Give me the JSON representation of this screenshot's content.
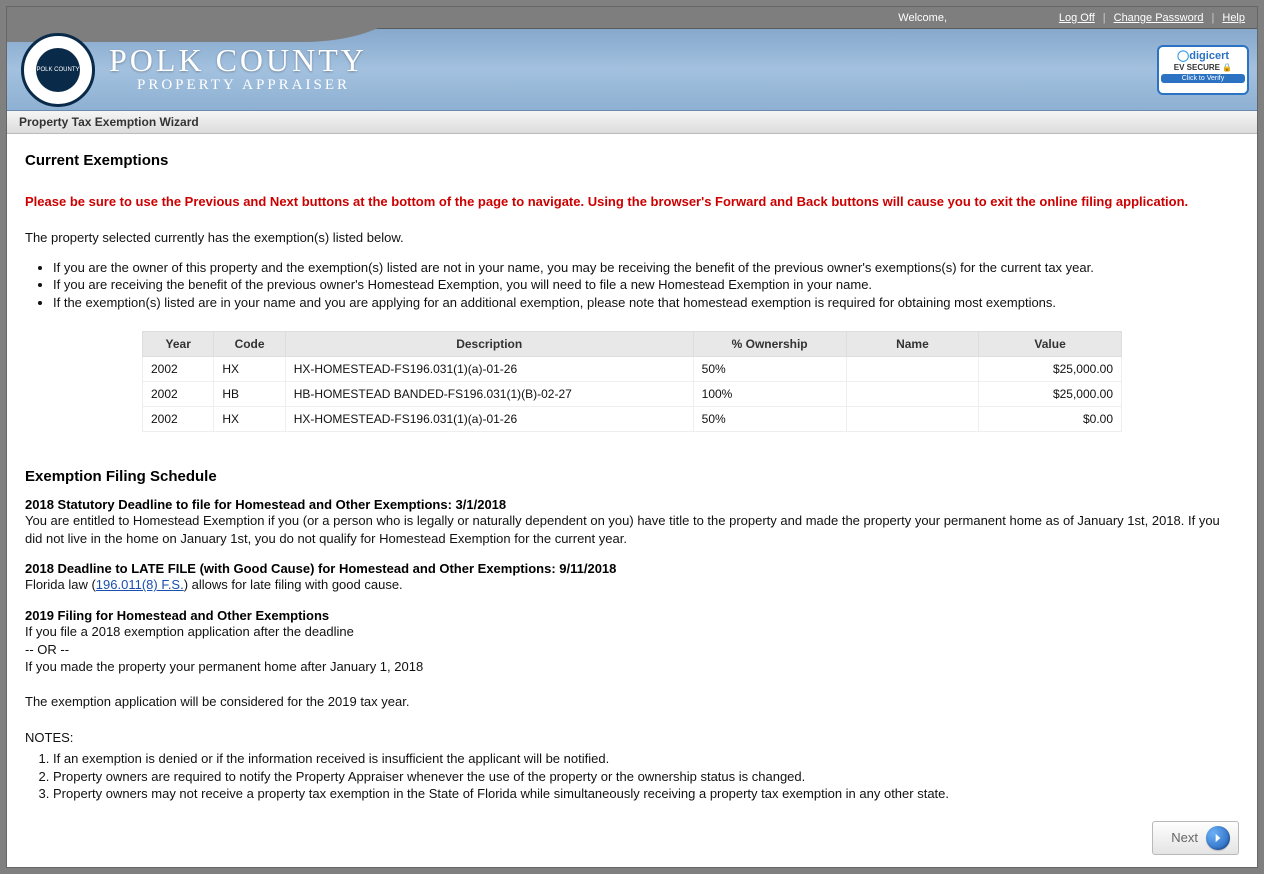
{
  "topbar": {
    "welcome": "Welcome,",
    "logoff": "Log Off",
    "change_pw": "Change Password",
    "help": "Help"
  },
  "banner": {
    "county": "POLK COUNTY",
    "sub": "PROPERTY APPRAISER",
    "seal_outer": "PROPERTY APPRAISER",
    "seal_inner": "POLK COUNTY"
  },
  "digicert": {
    "top": "digicert",
    "mid": "EV SECURE",
    "verify": "Click to Verify"
  },
  "wizard_title": "Property Tax Exemption Wizard",
  "section_current": "Current Exemptions",
  "warning_text": "Please be sure to use the Previous and Next buttons at the bottom of the page to navigate. Using the browser's Forward and Back buttons will cause you to exit the online filing application.",
  "intro": "The property selected currently has the exemption(s) listed below.",
  "bullets": [
    "If you are the owner of this property and the exemption(s) listed are not in your name, you may be receiving the benefit of the previous owner's exemptions(s) for the current tax year.",
    "If you are receiving the benefit of the previous owner's Homestead Exemption, you will need to file a new Homestead Exemption in your name.",
    "If the exemption(s) listed are in your name and you are applying for an additional exemption, please note that homestead exemption is required for obtaining most exemptions."
  ],
  "table": {
    "headers": {
      "year": "Year",
      "code": "Code",
      "desc": "Description",
      "own": "% Ownership",
      "name": "Name",
      "value": "Value"
    },
    "rows": [
      {
        "year": "2002",
        "code": "HX",
        "desc": "HX-HOMESTEAD-FS196.031(1)(a)-01-26",
        "own": "50%",
        "name": "",
        "value": "$25,000.00"
      },
      {
        "year": "2002",
        "code": "HB",
        "desc": "HB-HOMESTEAD BANDED-FS196.031(1)(B)-02-27",
        "own": "100%",
        "name": "",
        "value": "$25,000.00"
      },
      {
        "year": "2002",
        "code": "HX",
        "desc": "HX-HOMESTEAD-FS196.031(1)(a)-01-26",
        "own": "50%",
        "name": "",
        "value": "$0.00"
      }
    ]
  },
  "section_schedule": "Exemption Filing Schedule",
  "sched1": {
    "title": "2018 Statutory Deadline to file for Homestead and Other Exemptions: 3/1/2018",
    "body": "You are entitled to Homestead Exemption if you (or a person who is legally or naturally dependent on you) have title to the property and made the property your permanent home as of January 1st, 2018. If you did not live in the home on January 1st, you do not qualify for Homestead Exemption for the current year."
  },
  "sched2": {
    "title": "2018 Deadline to LATE FILE (with Good Cause) for Homestead and Other Exemptions: 9/11/2018",
    "body_pre": "Florida law (",
    "link": "196.011(8) F.S.",
    "body_post": ") allows for late filing with good cause."
  },
  "sched3": {
    "title": "2019 Filing for Homestead and Other Exemptions",
    "line1": "If you file a 2018 exemption application after the deadline",
    "line2": "-- OR --",
    "line3": "If you made the property your permanent home after January 1, 2018",
    "line4": "The exemption application will be considered for the 2019 tax year."
  },
  "notes_label": "NOTES:",
  "notes": [
    "If an exemption is denied or if the information received is insufficient the applicant will be notified.",
    "Property owners are required to notify the Property Appraiser whenever the use of the property or the ownership status is changed.",
    "Property owners may not receive a property tax exemption in the State of Florida while simultaneously receiving a property tax exemption in any other state."
  ],
  "next_label": "Next"
}
